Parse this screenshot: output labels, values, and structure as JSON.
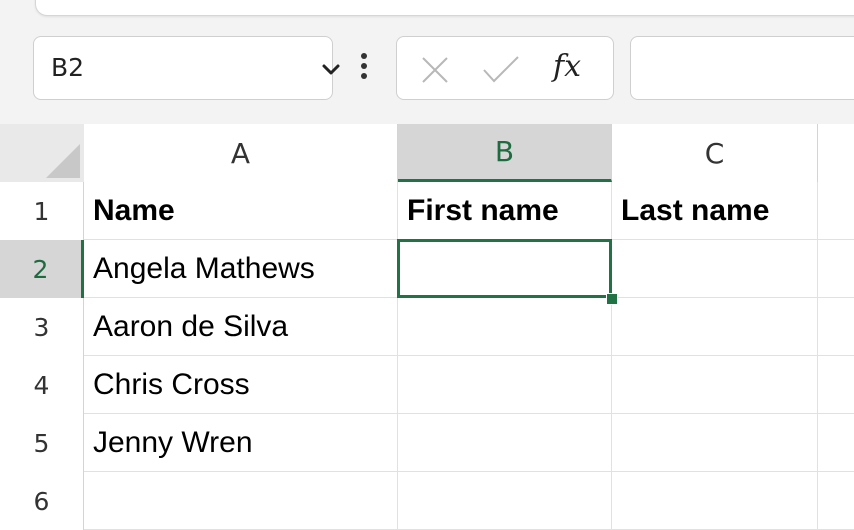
{
  "formula_bar": {
    "name_box": "B2",
    "formula_value": "",
    "icons": {
      "cancel": "close-icon",
      "enter": "check-icon",
      "function": "fx-icon"
    },
    "fx_label": "fx"
  },
  "columns": [
    "A",
    "B",
    "C"
  ],
  "rows": [
    "1",
    "2",
    "3",
    "4",
    "5",
    "6"
  ],
  "cells": {
    "A1": "Name",
    "B1": "First name",
    "C1": "Last name",
    "A2": "Angela Mathews",
    "B2": "",
    "C2": "",
    "A3": "Aaron de Silva",
    "B3": "",
    "C3": "",
    "A4": "Chris Cross",
    "B4": "",
    "C4": "",
    "A5": "Jenny Wren",
    "B5": "",
    "C5": "",
    "A6": "",
    "B6": "",
    "C6": ""
  },
  "selection": {
    "active_cell": "B2"
  },
  "colors": {
    "accent": "#217346",
    "header_bg": "#d6d6d6",
    "gridline": "#e1e1e1"
  }
}
